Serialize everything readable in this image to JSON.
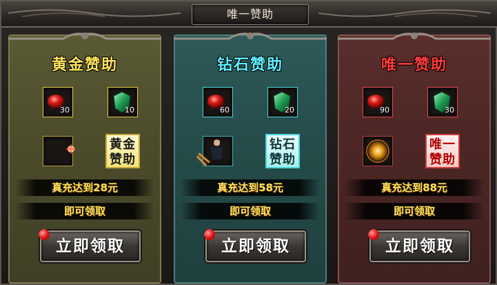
{
  "window": {
    "title": "唯一赞助"
  },
  "colors": {
    "gold": "#ffe45c",
    "diamond": "#5ff0ff",
    "unique": "#ff3b3b"
  },
  "tiers": [
    {
      "name": "黄金赞助",
      "items": [
        {
          "icon": "red-gem-icon",
          "count": "30"
        },
        {
          "icon": "green-armor-icon",
          "count": "10"
        },
        {
          "icon": "spark-item-icon",
          "count": ""
        }
      ],
      "badge": {
        "line1": "黄金",
        "line2": "赞助"
      },
      "requirement": "真充达到28元",
      "condition": "即可领取",
      "button": "立即领取"
    },
    {
      "name": "钻石赞助",
      "items": [
        {
          "icon": "red-gem-icon",
          "count": "60"
        },
        {
          "icon": "green-armor-icon",
          "count": "20"
        },
        {
          "icon": "warrior-figure-icon",
          "count": ""
        }
      ],
      "badge": {
        "line1": "钻石",
        "line2": "赞助"
      },
      "requirement": "真充达到58元",
      "condition": "即可领取",
      "button": "立即领取"
    },
    {
      "name": "唯一赞助",
      "items": [
        {
          "icon": "red-gem-icon",
          "count": "90"
        },
        {
          "icon": "green-armor-icon",
          "count": "30"
        },
        {
          "icon": "golden-orb-icon",
          "count": ""
        }
      ],
      "badge": {
        "line1": "唯一",
        "line2": "赞助"
      },
      "requirement": "真充达到88元",
      "condition": "即可领取",
      "button": "立即领取"
    }
  ]
}
